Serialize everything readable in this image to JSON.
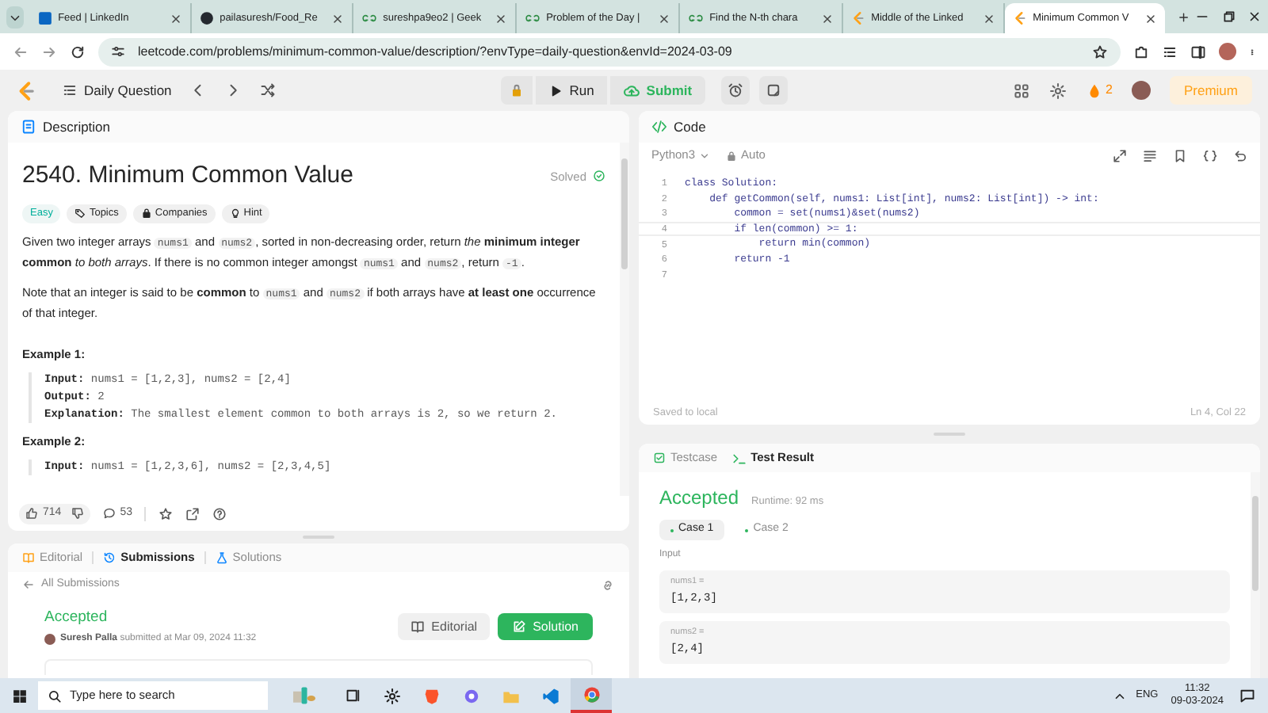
{
  "browser": {
    "tabs": [
      {
        "label": "Feed | LinkedIn",
        "kind": "linkedin",
        "selected": false
      },
      {
        "label": "pailasuresh/Food_Re",
        "kind": "github",
        "selected": false
      },
      {
        "label": "sureshpa9eo2 | Geek",
        "kind": "gfg",
        "selected": false
      },
      {
        "label": "Problem of the Day |",
        "kind": "gfg",
        "selected": false
      },
      {
        "label": "Find the N-th chara",
        "kind": "gfg",
        "selected": false
      },
      {
        "label": "Middle of the Linked",
        "kind": "leetcode",
        "selected": false
      },
      {
        "label": "Minimum Common V",
        "kind": "leetcode",
        "selected": true
      }
    ],
    "url": "leetcode.com/problems/minimum-common-value/description/?envType=daily-question&envId=2024-03-09"
  },
  "toolbar": {
    "title": "Daily Question",
    "run": "Run",
    "submit": "Submit",
    "streak": "2",
    "premium": "Premium"
  },
  "description": {
    "tab": "Description",
    "title": "2540. Minimum Common Value",
    "status": "Solved",
    "tags": [
      {
        "label": "Easy",
        "kind": "difficulty"
      },
      {
        "label": "Topics",
        "kind": "topics"
      },
      {
        "label": "Companies",
        "kind": "companies"
      },
      {
        "label": "Hint",
        "kind": "hint"
      }
    ],
    "paragraphs": [
      [
        {
          "kind": "text",
          "text": "Given two integer arrays "
        },
        {
          "kind": "code",
          "text": "nums1"
        },
        {
          "kind": "text",
          "text": " and "
        },
        {
          "kind": "code",
          "text": "nums2"
        },
        {
          "kind": "text",
          "text": ", sorted in non-decreasing order, return *the* **minimum integer common** *to both arrays*. If there is no common integer amongst "
        },
        {
          "kind": "code",
          "text": "nums1"
        },
        {
          "kind": "text",
          "text": " and "
        },
        {
          "kind": "code",
          "text": "nums2"
        },
        {
          "kind": "text",
          "text": ", return "
        },
        {
          "kind": "code",
          "text": "-1"
        },
        {
          "kind": "text",
          "text": "."
        }
      ],
      [
        {
          "kind": "text",
          "text": "Note that an integer is said to be **common** to "
        },
        {
          "kind": "code",
          "text": "nums1"
        },
        {
          "kind": "text",
          "text": " and "
        },
        {
          "kind": "code",
          "text": "nums2"
        },
        {
          "kind": "text",
          "text": " if both arrays have **at least one** occurrence of that integer."
        }
      ]
    ],
    "examples": [
      {
        "title": "Example 1:",
        "lines": [
          {
            "label": "Input:",
            "value": "nums1 = [1,2,3], nums2 = [2,4]"
          },
          {
            "label": "Output:",
            "value": "2"
          },
          {
            "label": "Explanation:",
            "value": "The smallest element common to both arrays is 2, so we return 2."
          }
        ]
      },
      {
        "title": "Example 2:",
        "lines": [
          {
            "label": "Input:",
            "value": "nums1 = [1,2,3,6], nums2 = [2,3,4,5]"
          }
        ]
      }
    ],
    "likes": "714",
    "comments": "53"
  },
  "submissions": {
    "tabs": [
      {
        "label": "Editorial",
        "kind": "book",
        "selected": false
      },
      {
        "label": "Submissions",
        "kind": "history",
        "selected": true
      },
      {
        "label": "Solutions",
        "kind": "flask",
        "selected": false
      }
    ],
    "back": "All Submissions",
    "status": "Accepted",
    "author": "Suresh Palla",
    "submitted": "submitted at Mar 09, 2024 11:32",
    "editorial_button": "Editorial",
    "solution_button": "Solution"
  },
  "code": {
    "tab": "Code",
    "language": "Python3",
    "mode": "Auto",
    "lines": [
      {
        "number": "1",
        "text": "class Solution:"
      },
      {
        "number": "2",
        "text": "    def getCommon(self, nums1: List[int], nums2: List[int]) -> int:"
      },
      {
        "number": "3",
        "text": "        common = set(nums1)&set(nums2)"
      },
      {
        "number": "4",
        "text": "        if len(common) >= 1:"
      },
      {
        "number": "5",
        "text": "            return min(common)"
      },
      {
        "number": "6",
        "text": "        return -1"
      },
      {
        "number": "7"
      }
    ],
    "saved": "Saved to local",
    "cursor": "Ln 4, Col 22"
  },
  "testcase": {
    "tabs": [
      {
        "label": "Testcase",
        "kind": "check",
        "selected": false
      },
      {
        "label": "Test Result",
        "kind": "terminal",
        "selected": true
      }
    ],
    "status": "Accepted",
    "runtime": "Runtime: 92 ms",
    "cases": [
      {
        "label": "Case 1",
        "selected": true
      },
      {
        "label": "Case 2",
        "selected": false
      }
    ],
    "input_label": "Input",
    "inputs": [
      {
        "name": "nums1 =",
        "value": "[1,2,3]"
      },
      {
        "name": "nums2 =",
        "value": "[2,4]"
      }
    ]
  },
  "taskbar": {
    "search": "Type here to search",
    "language": "ENG",
    "time": "11:32",
    "date": "09-03-2024"
  }
}
